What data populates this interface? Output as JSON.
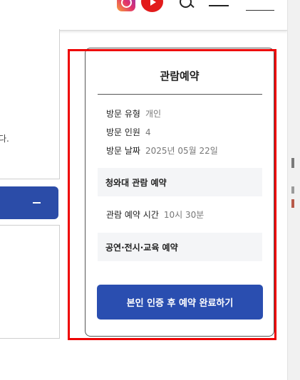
{
  "header": {
    "icons": [
      "instagram-icon",
      "youtube-icon",
      "search-icon",
      "menu-icon"
    ]
  },
  "background": {
    "left_text_fragment": "다."
  },
  "reservation": {
    "title": "관람예약",
    "visit_type_label": "방문 유형",
    "visit_type_value": "개인",
    "visit_count_label": "방문 인원",
    "visit_count_value": "4",
    "visit_date_label": "방문 날짜",
    "visit_date_value": "2025년 05월 22일",
    "section_cheongwadae": "청와대 관람 예약",
    "viewing_time_label": "관람 예약 시간",
    "viewing_time_value": "10시 30분",
    "section_performance": "공연·전시·교육 예약",
    "confirm_button": "본인 인증 후 예약 완료하기"
  },
  "colors": {
    "accent": "#2a4eb0",
    "highlight": "#ee0000",
    "section_bg": "#f4f5f7"
  }
}
